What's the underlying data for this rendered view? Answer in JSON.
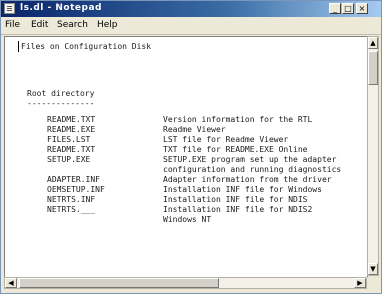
{
  "window": {
    "title": "ls.dl - Notepad"
  },
  "title_buttons": {
    "minimize": "_",
    "maximize": "□",
    "close": "×"
  },
  "menu": [
    "File",
    "Edit",
    "Search",
    "Help"
  ],
  "document": {
    "heading": "Files on Configuration Disk",
    "section": "Root directory",
    "underline": "--------------",
    "files": [
      {
        "name": "README.TXT",
        "desc": "Version information for the RTL"
      },
      {
        "name": "README.EXE",
        "desc": "Readme Viewer"
      },
      {
        "name": "FILES.LST",
        "desc": "LST file for Readme Viewer"
      },
      {
        "name": "README.TXT",
        "desc": "TXT file for README.EXE Online"
      },
      {
        "name": "SETUP.EXE",
        "desc": "SETUP.EXE program set up the adapter"
      },
      {
        "name": "",
        "desc": "configuration and running diagnostics"
      },
      {
        "name": "ADAPTER.INF",
        "desc": "Adapter information from the driver"
      },
      {
        "name": "OEMSETUP.INF",
        "desc": "Installation INF file for Windows"
      },
      {
        "name": "NETRTS.INF",
        "desc": "Installation INF file for NDIS"
      },
      {
        "name": "NETRTS.___",
        "desc": "Installation INF file for NDIS2"
      },
      {
        "name": "",
        "desc": "Windows NT"
      }
    ]
  },
  "icons": {
    "app": "notepad-icon",
    "scroll_up": "arrow-up-icon",
    "scroll_down": "arrow-down-icon",
    "scroll_left": "arrow-left-icon",
    "scroll_right": "arrow-right-icon"
  },
  "colors": {
    "title_start": "#0a246a",
    "title_end": "#a6caf0",
    "chrome": "#ece9d8",
    "text": "#1a1a1a"
  }
}
